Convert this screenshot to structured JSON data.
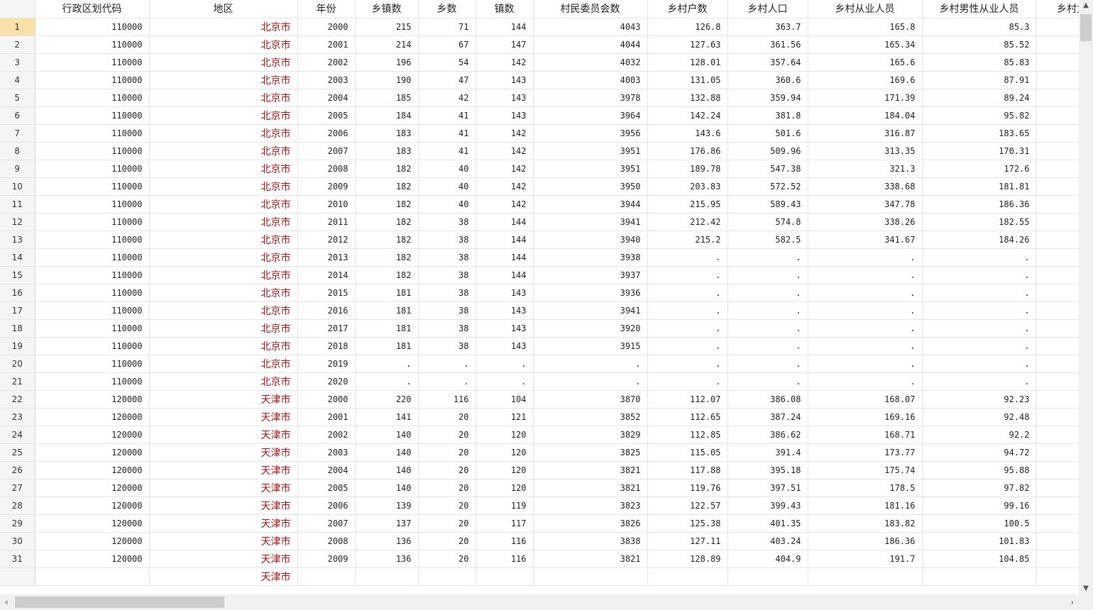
{
  "columns": [
    "行政区划代码",
    "地区",
    "年份",
    "乡镇数",
    "乡数",
    "镇数",
    "村民委员会数",
    "乡村户数",
    "乡村人口",
    "乡村从业人员",
    "乡村男性从业人员",
    "乡村女"
  ],
  "rows": [
    [
      "1",
      "110000",
      "北京市",
      "2000",
      "215",
      "71",
      "144",
      "4043",
      "126.8",
      "363.7",
      "165.8",
      "85.3",
      ""
    ],
    [
      "2",
      "110000",
      "北京市",
      "2001",
      "214",
      "67",
      "147",
      "4044",
      "127.63",
      "361.56",
      "165.34",
      "85.52",
      ""
    ],
    [
      "3",
      "110000",
      "北京市",
      "2002",
      "196",
      "54",
      "142",
      "4032",
      "128.01",
      "357.64",
      "165.6",
      "85.83",
      ""
    ],
    [
      "4",
      "110000",
      "北京市",
      "2003",
      "190",
      "47",
      "143",
      "4003",
      "131.05",
      "360.6",
      "169.6",
      "87.91",
      ""
    ],
    [
      "5",
      "110000",
      "北京市",
      "2004",
      "185",
      "42",
      "143",
      "3978",
      "132.88",
      "359.94",
      "171.39",
      "89.24",
      ""
    ],
    [
      "6",
      "110000",
      "北京市",
      "2005",
      "184",
      "41",
      "143",
      "3964",
      "142.24",
      "381.8",
      "184.04",
      "95.82",
      ""
    ],
    [
      "7",
      "110000",
      "北京市",
      "2006",
      "183",
      "41",
      "142",
      "3956",
      "143.6",
      "501.6",
      "316.87",
      "183.65",
      ""
    ],
    [
      "8",
      "110000",
      "北京市",
      "2007",
      "183",
      "41",
      "142",
      "3951",
      "176.86",
      "509.96",
      "313.35",
      "170.31",
      ""
    ],
    [
      "9",
      "110000",
      "北京市",
      "2008",
      "182",
      "40",
      "142",
      "3951",
      "189.78",
      "547.38",
      "321.3",
      "172.6",
      ""
    ],
    [
      "10",
      "110000",
      "北京市",
      "2009",
      "182",
      "40",
      "142",
      "3950",
      "203.83",
      "572.52",
      "338.68",
      "181.81",
      ""
    ],
    [
      "11",
      "110000",
      "北京市",
      "2010",
      "182",
      "40",
      "142",
      "3944",
      "215.95",
      "589.43",
      "347.78",
      "186.36",
      ""
    ],
    [
      "12",
      "110000",
      "北京市",
      "2011",
      "182",
      "38",
      "144",
      "3941",
      "212.42",
      "574.8",
      "338.26",
      "182.55",
      ""
    ],
    [
      "13",
      "110000",
      "北京市",
      "2012",
      "182",
      "38",
      "144",
      "3940",
      "215.2",
      "582.5",
      "341.67",
      "184.26",
      ""
    ],
    [
      "14",
      "110000",
      "北京市",
      "2013",
      "182",
      "38",
      "144",
      "3938",
      ".",
      ".",
      ".",
      ".",
      ""
    ],
    [
      "15",
      "110000",
      "北京市",
      "2014",
      "182",
      "38",
      "144",
      "3937",
      ".",
      ".",
      ".",
      ".",
      ""
    ],
    [
      "16",
      "110000",
      "北京市",
      "2015",
      "181",
      "38",
      "143",
      "3936",
      ".",
      ".",
      ".",
      ".",
      ""
    ],
    [
      "17",
      "110000",
      "北京市",
      "2016",
      "181",
      "38",
      "143",
      "3941",
      ".",
      ".",
      ".",
      ".",
      ""
    ],
    [
      "18",
      "110000",
      "北京市",
      "2017",
      "181",
      "38",
      "143",
      "3920",
      ".",
      ".",
      ".",
      ".",
      ""
    ],
    [
      "19",
      "110000",
      "北京市",
      "2018",
      "181",
      "38",
      "143",
      "3915",
      ".",
      ".",
      ".",
      ".",
      ""
    ],
    [
      "20",
      "110000",
      "北京市",
      "2019",
      ".",
      ".",
      ".",
      ".",
      ".",
      ".",
      ".",
      ".",
      ""
    ],
    [
      "21",
      "110000",
      "北京市",
      "2020",
      ".",
      ".",
      ".",
      ".",
      ".",
      ".",
      ".",
      ".",
      ""
    ],
    [
      "22",
      "120000",
      "天津市",
      "2000",
      "220",
      "116",
      "104",
      "3870",
      "112.07",
      "386.08",
      "168.07",
      "92.23",
      ""
    ],
    [
      "23",
      "120000",
      "天津市",
      "2001",
      "141",
      "20",
      "121",
      "3852",
      "112.65",
      "387.24",
      "169.16",
      "92.48",
      ""
    ],
    [
      "24",
      "120000",
      "天津市",
      "2002",
      "140",
      "20",
      "120",
      "3829",
      "112.85",
      "386.62",
      "168.71",
      "92.2",
      ""
    ],
    [
      "25",
      "120000",
      "天津市",
      "2003",
      "140",
      "20",
      "120",
      "3825",
      "115.05",
      "391.4",
      "173.77",
      "94.72",
      ""
    ],
    [
      "26",
      "120000",
      "天津市",
      "2004",
      "140",
      "20",
      "120",
      "3821",
      "117.88",
      "395.18",
      "175.74",
      "95.88",
      ""
    ],
    [
      "27",
      "120000",
      "天津市",
      "2005",
      "140",
      "20",
      "120",
      "3821",
      "119.76",
      "397.51",
      "178.5",
      "97.82",
      ""
    ],
    [
      "28",
      "120000",
      "天津市",
      "2006",
      "139",
      "20",
      "119",
      "3823",
      "122.57",
      "399.43",
      "181.16",
      "99.16",
      ""
    ],
    [
      "29",
      "120000",
      "天津市",
      "2007",
      "137",
      "20",
      "117",
      "3826",
      "125.38",
      "401.35",
      "183.82",
      "100.5",
      ""
    ],
    [
      "30",
      "120000",
      "天津市",
      "2008",
      "136",
      "20",
      "116",
      "3838",
      "127.11",
      "403.24",
      "186.36",
      "101.83",
      ""
    ],
    [
      "31",
      "120000",
      "天津市",
      "2009",
      "136",
      "20",
      "116",
      "3821",
      "128.89",
      "404.9",
      "191.7",
      "104.85",
      ""
    ],
    [
      "",
      "",
      "天津市",
      "",
      "",
      "",
      "",
      "",
      "",
      "",
      "",
      "",
      ""
    ]
  ],
  "active_row": "1",
  "scrollbar_icons": {
    "up": "chevron-up-icon",
    "down": "chevron-down-icon",
    "left": "chevron-left-icon",
    "right": "chevron-right-icon"
  },
  "colors": {
    "region_text": "#b01010",
    "active_row_header": "#f9dfa8",
    "row_header_bg": "#f5f5f5",
    "gridline": "#e3e3e3"
  }
}
